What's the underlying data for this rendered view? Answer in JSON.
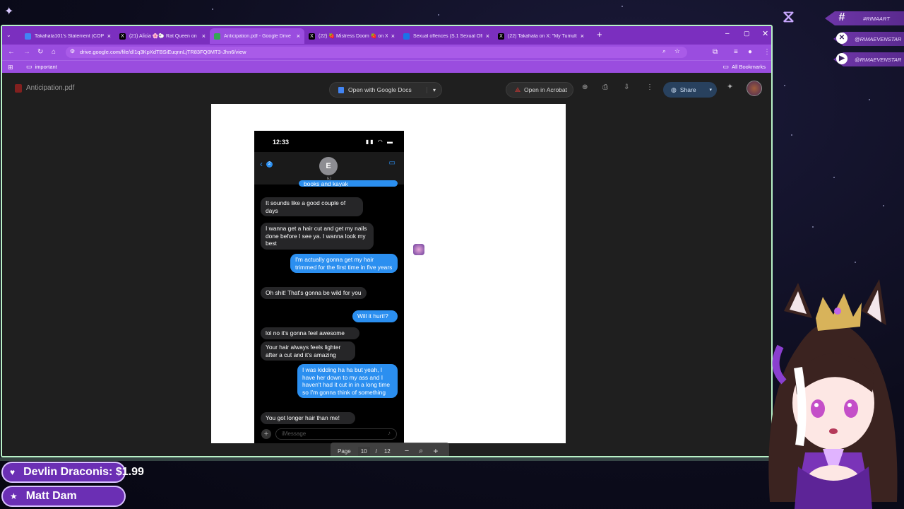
{
  "browser": {
    "tabs": [
      {
        "label": "Takahata101's Statement (COP",
        "icon": "doc-icon",
        "color": "#4285f4"
      },
      {
        "label": "(21) Alicia 🌸🐑 Rat Queen on",
        "icon": "x-icon",
        "color": "#000000"
      },
      {
        "label": "Anticipation.pdf - Google Drive",
        "icon": "drive-icon",
        "color": "#34a853",
        "active": true
      },
      {
        "label": "(22) 🍓 Mistress Doom 🍓 on X",
        "icon": "x-icon",
        "color": "#000000"
      },
      {
        "label": "Sexual offences (S.1 Sexual Offe",
        "icon": "site-icon",
        "color": "#1a73e8"
      },
      {
        "label": "(22) Takahata on X: \"My Tumult",
        "icon": "x-icon",
        "color": "#000000"
      }
    ],
    "url": "drive.google.com/file/d/1q3KpXdTBSiEuqnnLjTR83FQ0MT3-Jhn6/view",
    "bookmark_folder": "important",
    "all_bookmarks": "All Bookmarks"
  },
  "drive": {
    "file_name": "Anticipation.pdf",
    "open_with": "Open with Google Docs",
    "open_acrobat": "Open in Acrobat",
    "share": "Share"
  },
  "phone": {
    "time": "12:33",
    "contact_initial": "E",
    "contact_name": "EJ",
    "back_count": "2",
    "input_placeholder": "iMessage",
    "messages": [
      {
        "side": "sent",
        "text": "books and kayak"
      },
      {
        "side": "recv",
        "text": "It sounds like a good couple of days"
      },
      {
        "side": "recv",
        "text": "I wanna get a hair cut and get my nails done before I see ya. I wanna look my best"
      },
      {
        "side": "sent",
        "text": "I'm actually gonna get my hair trimmed for the first time in five years"
      },
      {
        "side": "recv",
        "text": "Oh shit! That's gonna be wild for you"
      },
      {
        "side": "sent",
        "text": "Will it hurt!?"
      },
      {
        "side": "recv",
        "text": "lol no it's gonna feel awesome"
      },
      {
        "side": "recv",
        "text": "Your hair always feels lighter after a cut and it's amazing"
      },
      {
        "side": "sent",
        "text": "I was kidding ha ha but yeah, I have her down to my ass and I haven't had it cut in in a long time so I'm gonna think of something"
      },
      {
        "side": "recv",
        "text": "You got longer hair than me!"
      }
    ]
  },
  "pagenav": {
    "label": "Page",
    "current": "10",
    "sep": "/",
    "total": "12"
  },
  "stream": {
    "socials": [
      {
        "icon": "hashtag-icon",
        "glyph": "#",
        "text": "#RIMAART"
      },
      {
        "icon": "x-icon",
        "glyph": "✕",
        "text": "@RIMAEVENSTAR"
      },
      {
        "icon": "youtube-icon",
        "glyph": "▶",
        "text": "@RIMAEVENSTAR"
      }
    ],
    "donations": [
      {
        "icon": "heart-icon",
        "glyph": "♥",
        "text": "Devlin Draconis: $1.99"
      },
      {
        "icon": "star-icon",
        "glyph": "★",
        "text": "Matt Dam"
      }
    ]
  },
  "colors": {
    "accent": "#9a4ddf",
    "tabbar": "#7b2fbf",
    "imessage_blue": "#2b8ff0",
    "frame": "#b9f2c8"
  }
}
